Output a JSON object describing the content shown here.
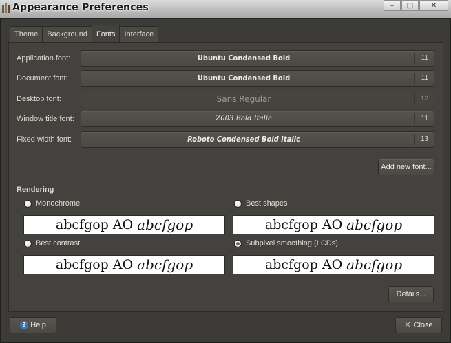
{
  "window": {
    "title": "Appearance Preferences",
    "buttons": [
      "–",
      "□",
      "✕"
    ]
  },
  "tabs": [
    {
      "label": "Theme",
      "active": false
    },
    {
      "label": "Background",
      "active": false
    },
    {
      "label": "Fonts",
      "active": true
    },
    {
      "label": "Interface",
      "active": false
    }
  ],
  "fonts": [
    {
      "label": "Application font:",
      "name": "Ubuntu Condensed Bold",
      "size": "11",
      "style": "bold"
    },
    {
      "label": "Document font:",
      "name": "Ubuntu Condensed Bold",
      "size": "11",
      "style": "bold"
    },
    {
      "label": "Desktop font:",
      "name": "Sans Regular",
      "size": "12",
      "style": "regular-disabled"
    },
    {
      "label": "Window title font:",
      "name": "Z003 Bold Italic",
      "size": "11",
      "style": "script"
    },
    {
      "label": "Fixed width font:",
      "name": "Roboto Condensed Bold Italic",
      "size": "13",
      "style": "bolditalic"
    }
  ],
  "add_font_label": "Add new font...",
  "rendering": {
    "title": "Rendering",
    "options": [
      {
        "label": "Monochrome",
        "checked": false,
        "preview_regular": "abcfgop AO",
        "preview_italic": "abcfgop"
      },
      {
        "label": "Best shapes",
        "checked": false,
        "preview_regular": "abcfgop AO",
        "preview_italic": "abcfgop"
      },
      {
        "label": "Best contrast",
        "checked": false,
        "preview_regular": "abcfgop AO",
        "preview_italic": "abcfgop"
      },
      {
        "label": "Subpixel smoothing (LCDs)",
        "checked": true,
        "preview_regular": "abcfgop AO",
        "preview_italic": "abcfgop"
      }
    ]
  },
  "details_label": "Details...",
  "help_label": "Help",
  "close_label": "Close"
}
